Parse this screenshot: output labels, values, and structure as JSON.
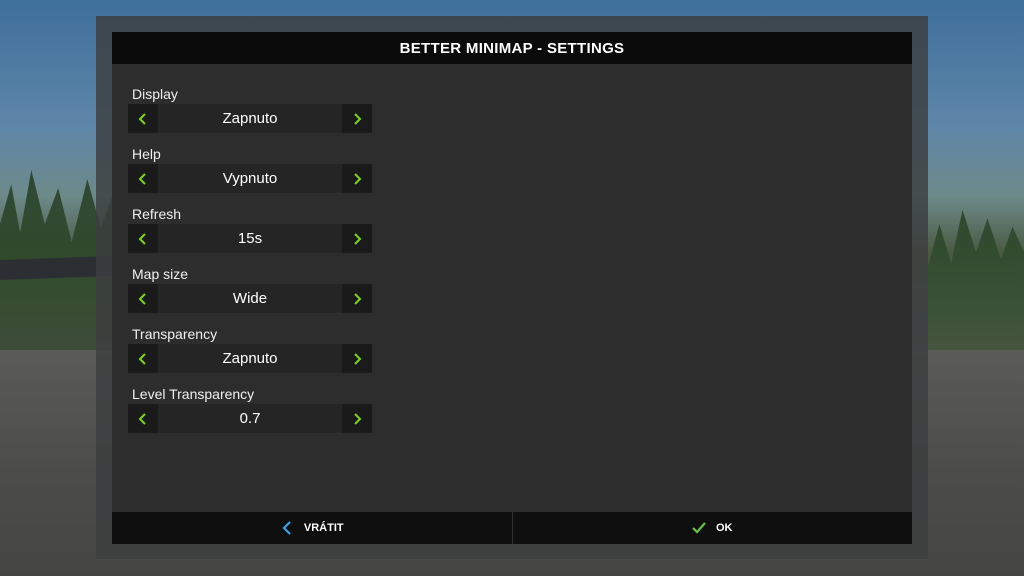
{
  "dialog": {
    "title": "BETTER MINIMAP - SETTINGS"
  },
  "settings": [
    {
      "label": "Display",
      "value": "Zapnuto"
    },
    {
      "label": "Help",
      "value": "Vypnuto"
    },
    {
      "label": "Refresh",
      "value": "15s"
    },
    {
      "label": "Map size",
      "value": "Wide"
    },
    {
      "label": "Transparency",
      "value": "Zapnuto"
    },
    {
      "label": "Level Transparency",
      "value": "0.7"
    }
  ],
  "footer": {
    "back_label": "VRÁTIT",
    "ok_label": "OK"
  },
  "icons": {
    "arrow_left": "chevron-left-icon",
    "arrow_right": "chevron-right-icon",
    "back": "chevron-left-icon",
    "ok": "checkmark-icon"
  },
  "colors": {
    "arrow_accent": "#7ed321",
    "back_accent": "#3aa0e6",
    "ok_accent": "#6cc04a",
    "title_bg": "#0b0b0b",
    "panel_bg": "#2d2d2d"
  }
}
